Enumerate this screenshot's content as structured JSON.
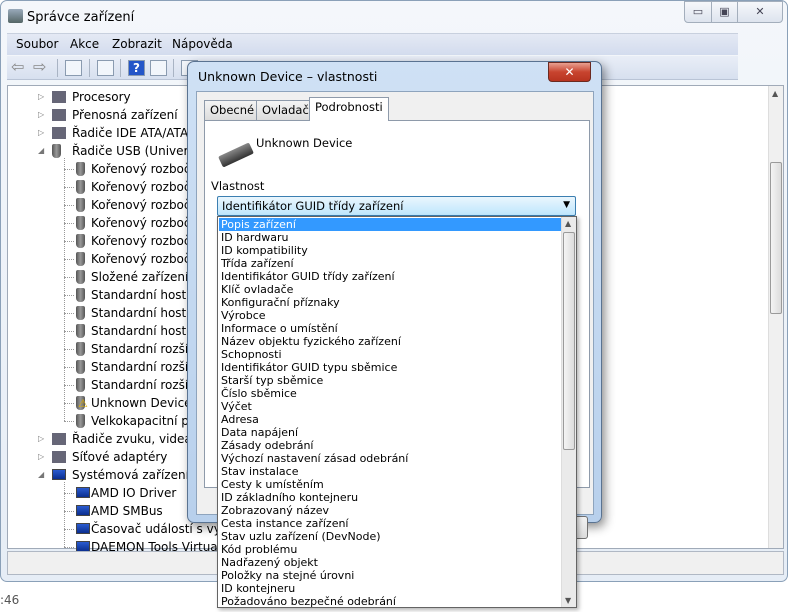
{
  "main_window": {
    "title": "Správce zařízení",
    "caption_buttons": {
      "minimize": "▭",
      "maximize": "▣",
      "close": "✕"
    },
    "menu": [
      "Soubor",
      "Akce",
      "Zobrazit",
      "Nápověda"
    ],
    "tree": [
      {
        "label": "Procesory",
        "level": 1,
        "expander": "▷",
        "icon": "cpu-icon"
      },
      {
        "label": "Přenosná zařízení",
        "level": 1,
        "expander": "▷",
        "icon": "portable-device-icon"
      },
      {
        "label": "Řadiče IDE ATA/ATAPI",
        "level": 1,
        "expander": "▷",
        "icon": "ide-controller-icon"
      },
      {
        "label": "Řadiče USB (Universal",
        "level": 1,
        "expander": "◢",
        "icon": "usb-icon"
      },
      {
        "label": "Kořenový rozbočov",
        "level": 2,
        "icon": "usb-icon"
      },
      {
        "label": "Kořenový rozbočov",
        "level": 2,
        "icon": "usb-icon"
      },
      {
        "label": "Kořenový rozbočov",
        "level": 2,
        "icon": "usb-icon"
      },
      {
        "label": "Kořenový rozbočov",
        "level": 2,
        "icon": "usb-icon"
      },
      {
        "label": "Kořenový rozbočov",
        "level": 2,
        "icon": "usb-icon"
      },
      {
        "label": "Kořenový rozbočov",
        "level": 2,
        "icon": "usb-icon"
      },
      {
        "label": "Složené zařízení US",
        "level": 2,
        "icon": "usb-icon"
      },
      {
        "label": "Standardní hostitel",
        "level": 2,
        "icon": "usb-icon"
      },
      {
        "label": "Standardní hostitel",
        "level": 2,
        "icon": "usb-icon"
      },
      {
        "label": "Standardní hostitel",
        "level": 2,
        "icon": "usb-icon"
      },
      {
        "label": "Standardní rozšířen",
        "level": 2,
        "icon": "usb-icon"
      },
      {
        "label": "Standardní rozšířen",
        "level": 2,
        "icon": "usb-icon"
      },
      {
        "label": "Standardní rozšířen",
        "level": 2,
        "icon": "usb-icon"
      },
      {
        "label": "Unknown Device",
        "level": 2,
        "icon": "usb-warning-icon"
      },
      {
        "label": "Velkokapacitní pam",
        "level": 2,
        "icon": "usb-icon"
      },
      {
        "label": "Řadiče zvuku, videa a h",
        "level": 1,
        "expander": "▷",
        "icon": "speaker-icon"
      },
      {
        "label": "Síťové adaptéry",
        "level": 1,
        "expander": "▷",
        "icon": "network-icon"
      },
      {
        "label": "Systémová zařízení",
        "level": 1,
        "expander": "◢",
        "icon": "system-device-icon"
      },
      {
        "label": "AMD IO Driver",
        "level": 2,
        "icon": "system-device-icon"
      },
      {
        "label": "AMD SMBus",
        "level": 2,
        "icon": "system-device-icon"
      },
      {
        "label": "Časovač událostí s vysok",
        "level": 2,
        "icon": "system-device-icon"
      },
      {
        "label": "DAEMON Tools Virtual B",
        "level": 2,
        "icon": "system-device-icon"
      }
    ]
  },
  "desktop_clock_fragment": ":46",
  "dialog": {
    "title": "Unknown Device – vlastnosti",
    "close": "✕",
    "tabs": [
      "Obecné",
      "Ovladač",
      "Podrobnosti"
    ],
    "active_tab": "Podrobnosti",
    "device_name": "Unknown Device",
    "property_label": "Vlastnost",
    "property_selected": "Identifikátor GUID třídy zařízení",
    "dropdown_items": [
      "Popis zařízení",
      "ID hardwaru",
      "ID kompatibility",
      "Třída zařízení",
      "Identifikátor GUID třídy zařízení",
      "Klíč ovladače",
      "Konfigurační příznaky",
      "Výrobce",
      "Informace o umístění",
      "Název objektu fyzického zařízení",
      "Schopnosti",
      "Identifikátor GUID typu sběmice",
      "Starší typ sběmice",
      "Číslo sběmice",
      "Výčet",
      "Adresa",
      "Data napájení",
      "Zásady odebrání",
      "Výchozí nastavení zásad odebrání",
      "Stav instalace",
      "Cesty k umístěním",
      "ID základního kontejneru",
      "Zobrazovaný název",
      "Cesta instance zařízení",
      "Stav uzlu zařízení (DevNode)",
      "Kód problému",
      "Nadřazený objekt",
      "Položky na stejné úrovni",
      "ID kontejneru",
      "Požadováno bezpečné odebrání"
    ],
    "highlighted_index": 0,
    "colors": {
      "highlight": "#3399ff"
    }
  }
}
